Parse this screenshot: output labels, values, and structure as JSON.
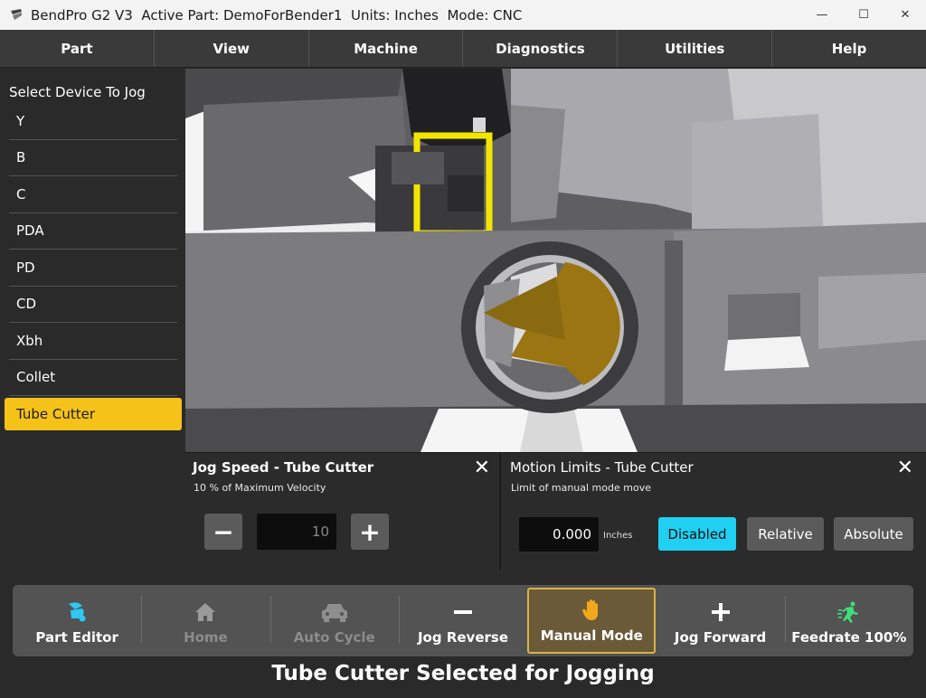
{
  "window": {
    "title": "BendPro G2 V3  Active Part: DemoForBender1  Units: Inches  Mode: CNC",
    "controls": {
      "minimize": "—",
      "maximize": "☐",
      "close": "✕"
    }
  },
  "menu": [
    "Part",
    "View",
    "Machine",
    "Diagnostics",
    "Utilities",
    "Help"
  ],
  "sidebar": {
    "title": "Select Device To Jog",
    "devices": [
      "Y",
      "B",
      "C",
      "PDA",
      "PD",
      "CD",
      "Xbh",
      "Collet",
      "Tube Cutter"
    ],
    "selected": "Tube Cutter"
  },
  "jog_panel": {
    "title": "Jog Speed - Tube Cutter",
    "subtitle": "10 % of Maximum Velocity",
    "minus": "−",
    "plus": "+",
    "value": "10",
    "close": "✕"
  },
  "limits_panel": {
    "title": "Motion Limits - Tube Cutter",
    "subtitle": "Limit of manual mode move",
    "value": "0.000",
    "unit": "Inches",
    "buttons": [
      "Disabled",
      "Relative",
      "Absolute"
    ],
    "active_button": "Disabled",
    "close": "✕"
  },
  "toolbar": {
    "items": [
      {
        "label": "Part Editor",
        "icon": "part-editor-icon",
        "state": "enabled"
      },
      {
        "label": "Home",
        "icon": "home-icon",
        "state": "disabled"
      },
      {
        "label": "Auto Cycle",
        "icon": "car-icon",
        "state": "disabled"
      },
      {
        "label": "Jog Reverse",
        "icon": "minus-icon",
        "state": "enabled"
      },
      {
        "label": "Manual Mode",
        "icon": "hand-icon",
        "state": "active"
      },
      {
        "label": "Jog Forward",
        "icon": "plus-icon",
        "state": "enabled"
      },
      {
        "label": "Feedrate 100%",
        "icon": "running-man-icon",
        "state": "enabled"
      }
    ]
  },
  "status": "Tube Cutter Selected for Jogging",
  "colors": {
    "selected": "#f5c21a",
    "active_mode": "#1fd0f2",
    "manual_mode_bg": "#6b5a38",
    "highlight_yellow": "#f2e600",
    "cutter_blade": "#9a7512"
  }
}
